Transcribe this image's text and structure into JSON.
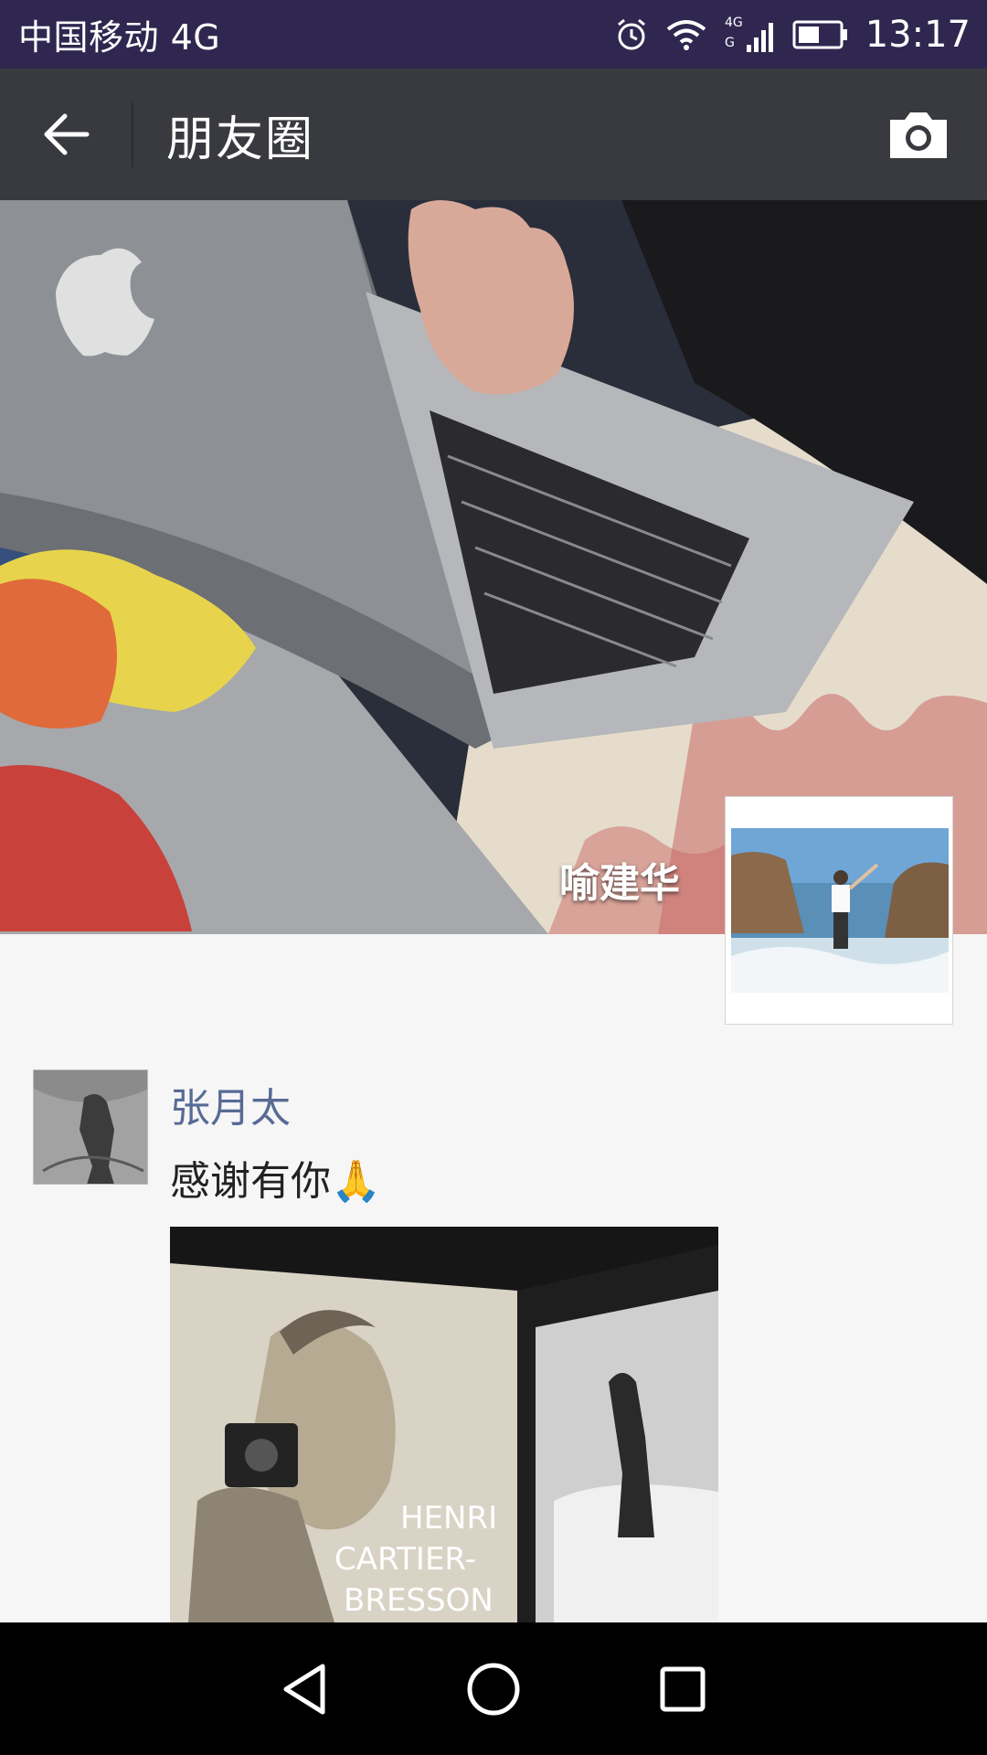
{
  "status_bar": {
    "carrier": "中国移动 4G",
    "network_badge": "4G",
    "time": "13:17",
    "icons": [
      "alarm-icon",
      "wifi-icon",
      "signal-icon",
      "battery-icon"
    ]
  },
  "header": {
    "title": "朋友圈",
    "back_icon": "arrow-left-icon",
    "camera_icon": "camera-icon"
  },
  "cover": {
    "owner_name": "喻建华"
  },
  "post": {
    "author": "张月太",
    "text": "感谢有你🙏",
    "image_text": [
      "HENRI",
      "CARTIER-",
      "BRESSON"
    ]
  },
  "nav_bar": {
    "icons": [
      "back-triangle-icon",
      "home-circle-icon",
      "recents-square-icon"
    ]
  },
  "colors": {
    "status_bar_bg": "#2f2750",
    "top_bar_bg": "#393a3f",
    "author_link": "#576b95",
    "page_bg": "#f6f6f6"
  }
}
